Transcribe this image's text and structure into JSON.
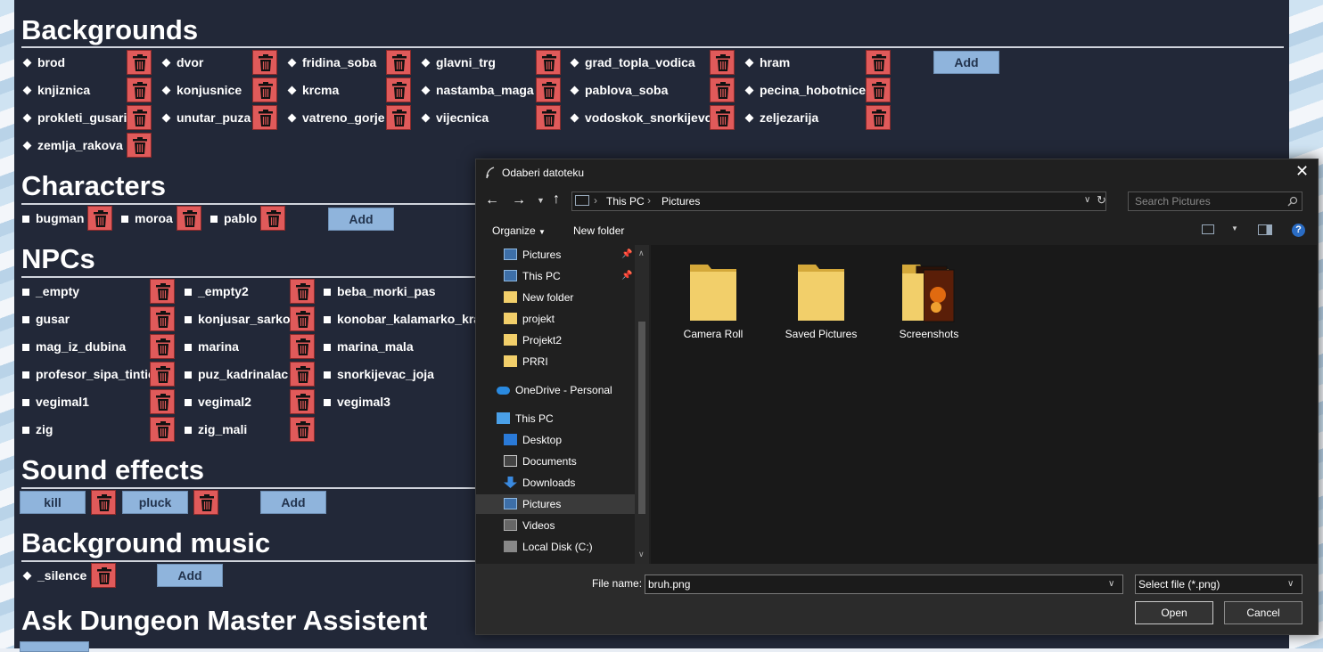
{
  "sections": {
    "backgrounds": {
      "title": "Backgrounds",
      "items": [
        "brod",
        "dvor",
        "fridina_soba",
        "glavni_trg",
        "grad_topla_vodica",
        "hram",
        "knjiznica",
        "konjusnice",
        "krcma",
        "nastamba_maga",
        "pablova_soba",
        "pecina_hobotnice",
        "prokleti_gusari",
        "unutar_puza",
        "vatreno_gorje",
        "vijecnica",
        "vodoskok_snorkijevci",
        "zeljezarija",
        "zemlja_rakova"
      ],
      "add_label": "Add"
    },
    "characters": {
      "title": "Characters",
      "items": [
        "bugman",
        "moroa",
        "pablo"
      ],
      "add_label": "Add"
    },
    "npcs": {
      "title": "NPCs",
      "items": [
        "_empty",
        "_empty2",
        "beba_morki_pas",
        "gusar",
        "konjusar_sarko",
        "konobar_kalamarko_krak",
        "mag_iz_dubina",
        "marina",
        "marina_mala",
        "profesor_sipa_tintic",
        "puz_kadrinalac",
        "snorkijevac_joja",
        "vegimal1",
        "vegimal2",
        "vegimal3",
        "zig",
        "zig_mali"
      ]
    },
    "sound_effects": {
      "title": "Sound effects",
      "items": [
        "kill",
        "pluck"
      ],
      "add_label": "Add"
    },
    "background_music": {
      "title": "Background music",
      "items": [
        "_silence"
      ],
      "add_label": "Add"
    },
    "assistant": {
      "title": "Ask Dungeon Master Assistent"
    }
  },
  "dialog": {
    "title": "Odaberi datoteku",
    "breadcrumb": [
      "This PC",
      "Pictures"
    ],
    "search_placeholder": "Search Pictures",
    "toolbar": {
      "organize": "Organize",
      "new_folder": "New folder"
    },
    "nav": {
      "pinned": [
        "Pictures",
        "This PC",
        "New folder",
        "projekt",
        "Projekt2",
        "PRRI"
      ],
      "onedrive": "OneDrive - Personal",
      "this_pc": "This PC",
      "this_pc_children": [
        "Desktop",
        "Documents",
        "Downloads",
        "Pictures",
        "Videos",
        "Local Disk (C:)"
      ],
      "selected": "Pictures"
    },
    "folders": [
      "Camera Roll",
      "Saved Pictures",
      "Screenshots"
    ],
    "file_name_label": "File name:",
    "file_name_value": "bruh.png",
    "file_type": "Select file (*.png)",
    "open_label": "Open",
    "cancel_label": "Cancel"
  },
  "colors": {
    "app_bg": "#222838",
    "delete_button": "#e05a5a",
    "add_button": "#8fb4dc",
    "dialog_bg": "#202020"
  }
}
